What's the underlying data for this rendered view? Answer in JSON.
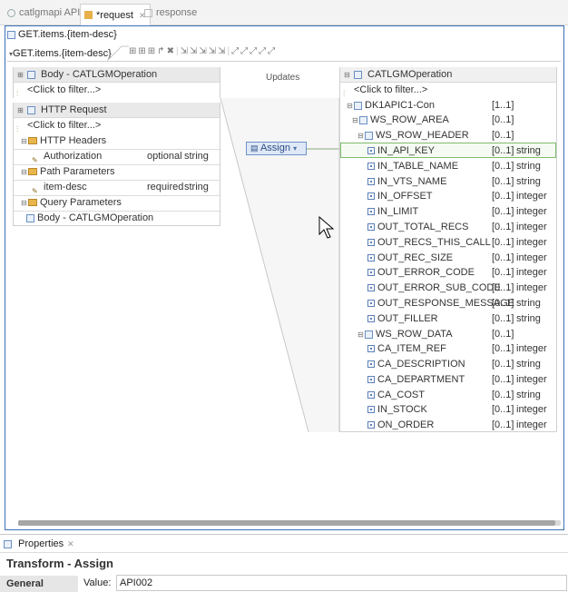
{
  "tabs": [
    {
      "label": "catlgmapi API",
      "active": false
    },
    {
      "label": "*request",
      "active": true
    },
    {
      "label": "response",
      "active": false
    }
  ],
  "breadcrumb": "GET.items.{item-desc}",
  "subtab": "GET.items.{item-desc}",
  "updates_label": "Updates",
  "assign_label": "Assign",
  "left": {
    "body_title": "Body - CATLGMOperation",
    "filter": "<Click to filter...>",
    "http_title": "HTTP Request",
    "http_filter": "<Click to filter...>",
    "rows": [
      {
        "label": "HTTP Headers",
        "card": "",
        "type": ""
      },
      {
        "label": "Authorization",
        "card": "optional",
        "type": "string"
      },
      {
        "label": "Path Parameters",
        "card": "",
        "type": ""
      },
      {
        "label": "item-desc",
        "card": "required",
        "type": "string"
      },
      {
        "label": "Query Parameters",
        "card": "",
        "type": ""
      },
      {
        "label": "Body - CATLGMOperation",
        "card": "",
        "type": ""
      }
    ]
  },
  "right": {
    "title": "CATLGMOperation",
    "filter": "<Click to filter...>",
    "rows": [
      {
        "label": "DK1APIC1-Con",
        "card": "[1..1]",
        "type": ""
      },
      {
        "label": "WS_ROW_AREA",
        "card": "[0..1]",
        "type": ""
      },
      {
        "label": "WS_ROW_HEADER",
        "card": "[0..1]",
        "type": ""
      },
      {
        "label": "IN_API_KEY",
        "card": "[0..1]",
        "type": "string"
      },
      {
        "label": "IN_TABLE_NAME",
        "card": "[0..1]",
        "type": "string"
      },
      {
        "label": "IN_VTS_NAME",
        "card": "[0..1]",
        "type": "string"
      },
      {
        "label": "IN_OFFSET",
        "card": "[0..1]",
        "type": "integer"
      },
      {
        "label": "IN_LIMIT",
        "card": "[0..1]",
        "type": "integer"
      },
      {
        "label": "OUT_TOTAL_RECS",
        "card": "[0..1]",
        "type": "integer"
      },
      {
        "label": "OUT_RECS_THIS_CALL",
        "card": "[0..1]",
        "type": "integer"
      },
      {
        "label": "OUT_REC_SIZE",
        "card": "[0..1]",
        "type": "integer"
      },
      {
        "label": "OUT_ERROR_CODE",
        "card": "[0..1]",
        "type": "integer"
      },
      {
        "label": "OUT_ERROR_SUB_CODE",
        "card": "[0..1]",
        "type": "integer"
      },
      {
        "label": "OUT_RESPONSE_MESSAGE",
        "card": "[0..1]",
        "type": "string"
      },
      {
        "label": "OUT_FILLER",
        "card": "[0..1]",
        "type": "string"
      },
      {
        "label": "WS_ROW_DATA",
        "card": "[0..1]",
        "type": ""
      },
      {
        "label": "CA_ITEM_REF",
        "card": "[0..1]",
        "type": "integer"
      },
      {
        "label": "CA_DESCRIPTION",
        "card": "[0..1]",
        "type": "string"
      },
      {
        "label": "CA_DEPARTMENT",
        "card": "[0..1]",
        "type": "integer"
      },
      {
        "label": "CA_COST",
        "card": "[0..1]",
        "type": "string"
      },
      {
        "label": "IN_STOCK",
        "card": "[0..1]",
        "type": "integer"
      },
      {
        "label": "ON_ORDER",
        "card": "[0..1]",
        "type": "integer"
      }
    ]
  },
  "properties": {
    "tab_label": "Properties",
    "title": "Transform - Assign",
    "section": "General",
    "value_label": "Value:",
    "value": "API002"
  }
}
